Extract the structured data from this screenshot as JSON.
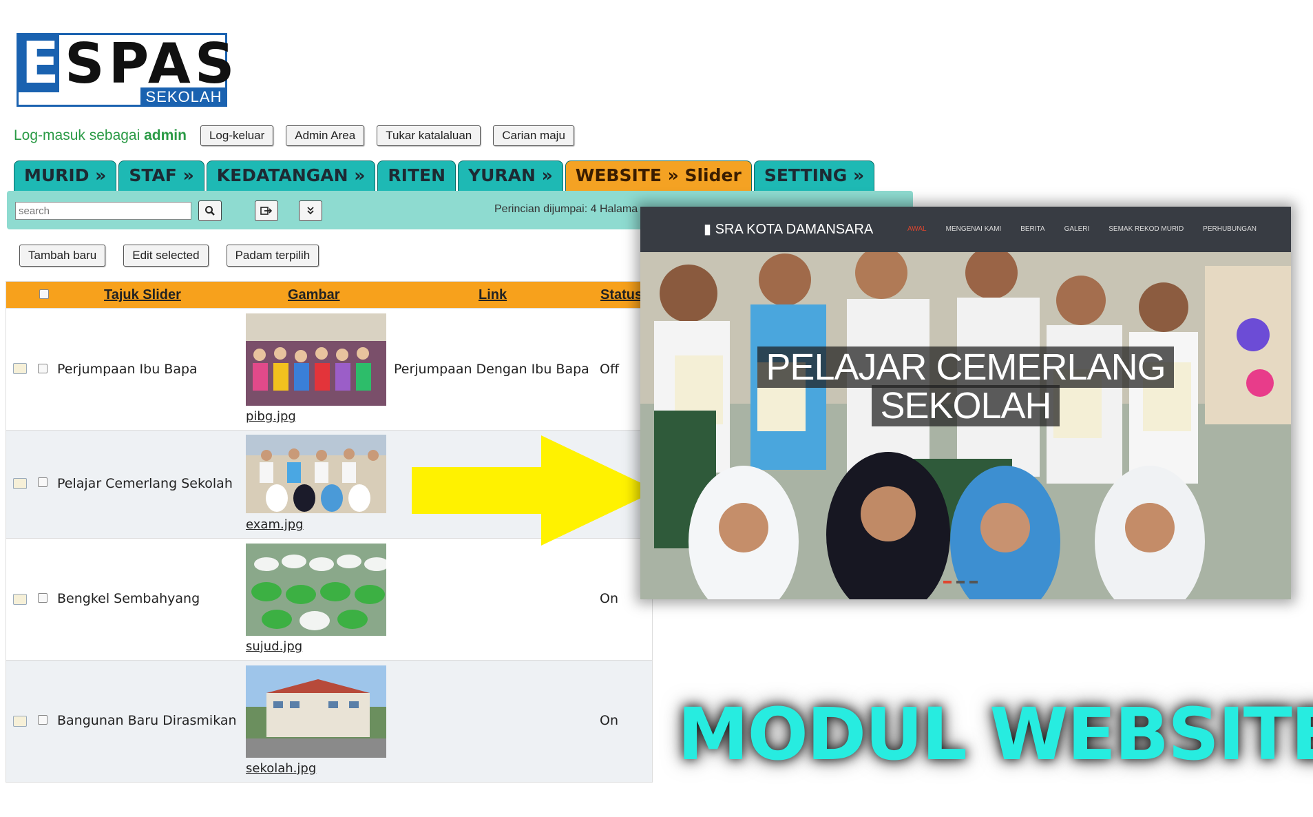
{
  "logo": {
    "word": "SPAS",
    "letter": "E",
    "sub": "SEKOLAH"
  },
  "login": {
    "prefix": "Log-masuk sebagai",
    "user": "admin",
    "buttons": [
      "Log-keluar",
      "Admin Area",
      "Tukar katalaluan",
      "Carian maju"
    ]
  },
  "tabs": [
    "MURID »",
    "STAF »",
    "KEDATANGAN »",
    "RITEN",
    "YURAN »",
    "WEBSITE » Slider",
    "SETTING »"
  ],
  "toolbar": {
    "search_placeholder": "search",
    "found_text": "Perincian dijumpai: 4  Halama"
  },
  "actions": [
    "Tambah baru",
    "Edit selected",
    "Padam terpilih"
  ],
  "table": {
    "headers": [
      "Tajuk Slider",
      "Gambar",
      "Link",
      "Status"
    ],
    "rows": [
      {
        "title": "Perjumpaan Ibu Bapa",
        "file": "pibg.jpg",
        "link": "Perjumpaan Dengan Ibu Bapa",
        "status": "Off"
      },
      {
        "title": "Pelajar Cemerlang Sekolah",
        "file": "exam.jpg",
        "link": "",
        "status": ""
      },
      {
        "title": "Bengkel Sembahyang",
        "file": "sujud.jpg",
        "link": "",
        "status": "On"
      },
      {
        "title": "Bangunan Baru Dirasmikan",
        "file": "sekolah.jpg",
        "link": "",
        "status": "On"
      }
    ]
  },
  "preview": {
    "brand": "SRA KOTA DAMANSARA",
    "menu": [
      "AWAL",
      "MENGENAI KAMI",
      "BERITA",
      "GALERI",
      "SEMAK REKOD MURID",
      "PERHUBUNGAN"
    ],
    "caption_line1": "PELAJAR CEMERLANG",
    "caption_line2": "SEKOLAH"
  },
  "label": "MODUL WEBSITE",
  "colors": {
    "teal": "#1eb9b4",
    "orange": "#f7a11c",
    "accent": "#27ece0",
    "arrow": "#fff200"
  }
}
